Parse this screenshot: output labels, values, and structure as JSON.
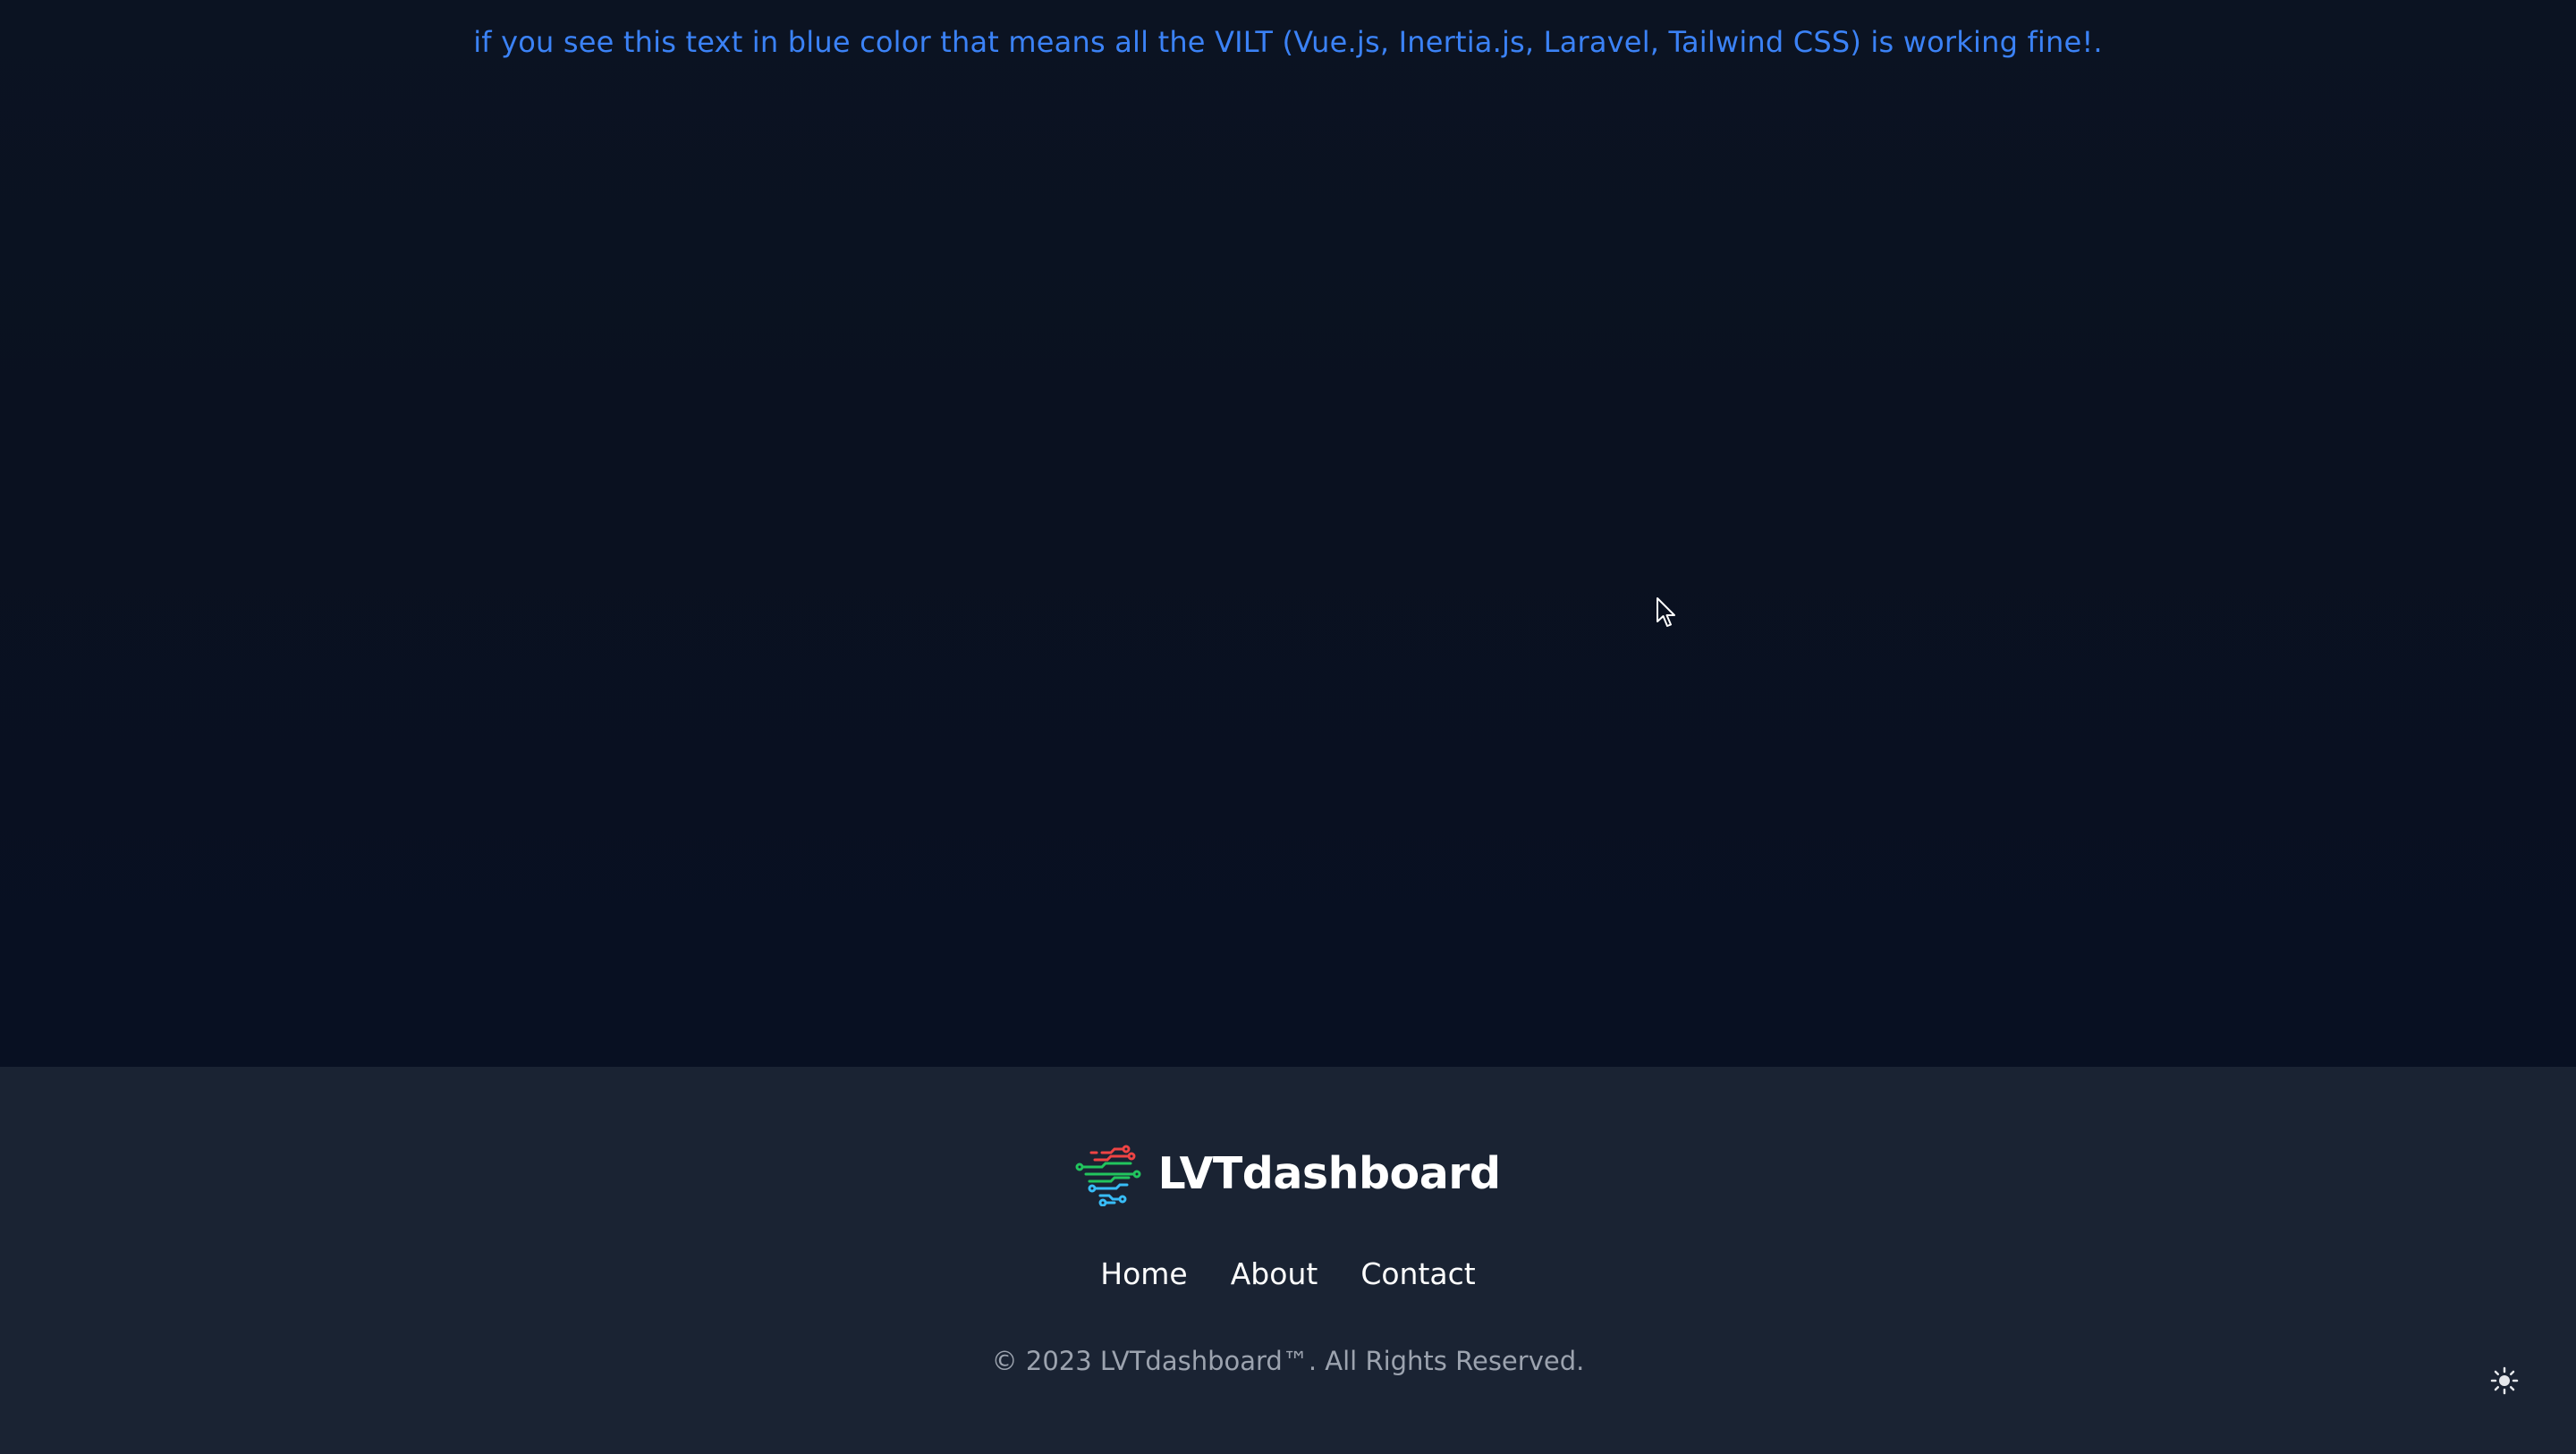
{
  "notice": {
    "text": "if you see this text in blue color that means all the VILT (Vue.js, Inertia.js, Laravel, Tailwind CSS) is working fine!.",
    "color": "#3b82f6"
  },
  "footer": {
    "brand_name": "LVTdashboard",
    "logo_icon": "circuit-logo-icon",
    "nav": [
      {
        "label": "Home"
      },
      {
        "label": "About"
      },
      {
        "label": "Contact"
      }
    ],
    "copyright": "© 2023 LVTdashboard™. All Rights Reserved.",
    "theme_toggle_icon": "sun-icon"
  },
  "colors": {
    "background": "#0a1120",
    "footer_background": "#1a2333",
    "logo_red": "#ef4444",
    "logo_green": "#22c55e",
    "logo_blue": "#38bdf8",
    "muted_text": "#9ca3af"
  }
}
